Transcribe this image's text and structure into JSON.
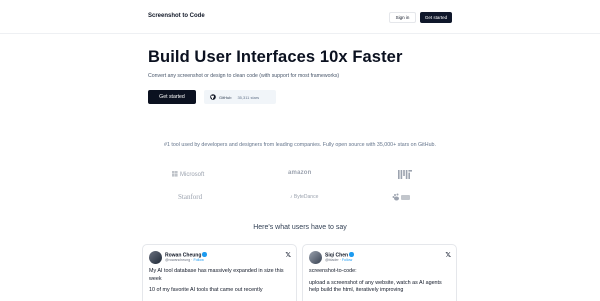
{
  "header": {
    "brand": "Screenshot to Code",
    "signin_label": "Sign in",
    "getstarted_label": "Get started"
  },
  "hero": {
    "title": "Build User Interfaces 10x Faster",
    "subtitle": "Convert any screenshot or design to clean code (with support for most frameworks)",
    "primary_button": "Get started",
    "github_label": "GitHub",
    "github_stars": "35,311 stars"
  },
  "social_proof": {
    "text": "#1 tool used by developers and designers from leading companies. Fully open source with 35,000+ stars on GitHub.",
    "logos": [
      "Microsoft",
      "amazon",
      "MIT",
      "Stanford",
      "ByteDance",
      "Baidu"
    ]
  },
  "testimonials": {
    "heading": "Here's what users have to say",
    "items": [
      {
        "name": "Rowan Cheung",
        "handle": "@rowancheung",
        "follow": "Follow",
        "lines": [
          "My AI tool database has massively expanded in size this week",
          "10 of my favorite AI tools that came out recently"
        ]
      },
      {
        "name": "Siqi Chen",
        "handle": "@blader",
        "follow": "Follow",
        "lines": [
          "screenshot-to-code:",
          "upload a screenshot of any website, watch as AI agents help build the html, iteratively improving"
        ]
      }
    ]
  },
  "colors": {
    "primary": "#0b1120",
    "muted_text": "#64748b",
    "verified_blue": "#1d9bf0"
  }
}
